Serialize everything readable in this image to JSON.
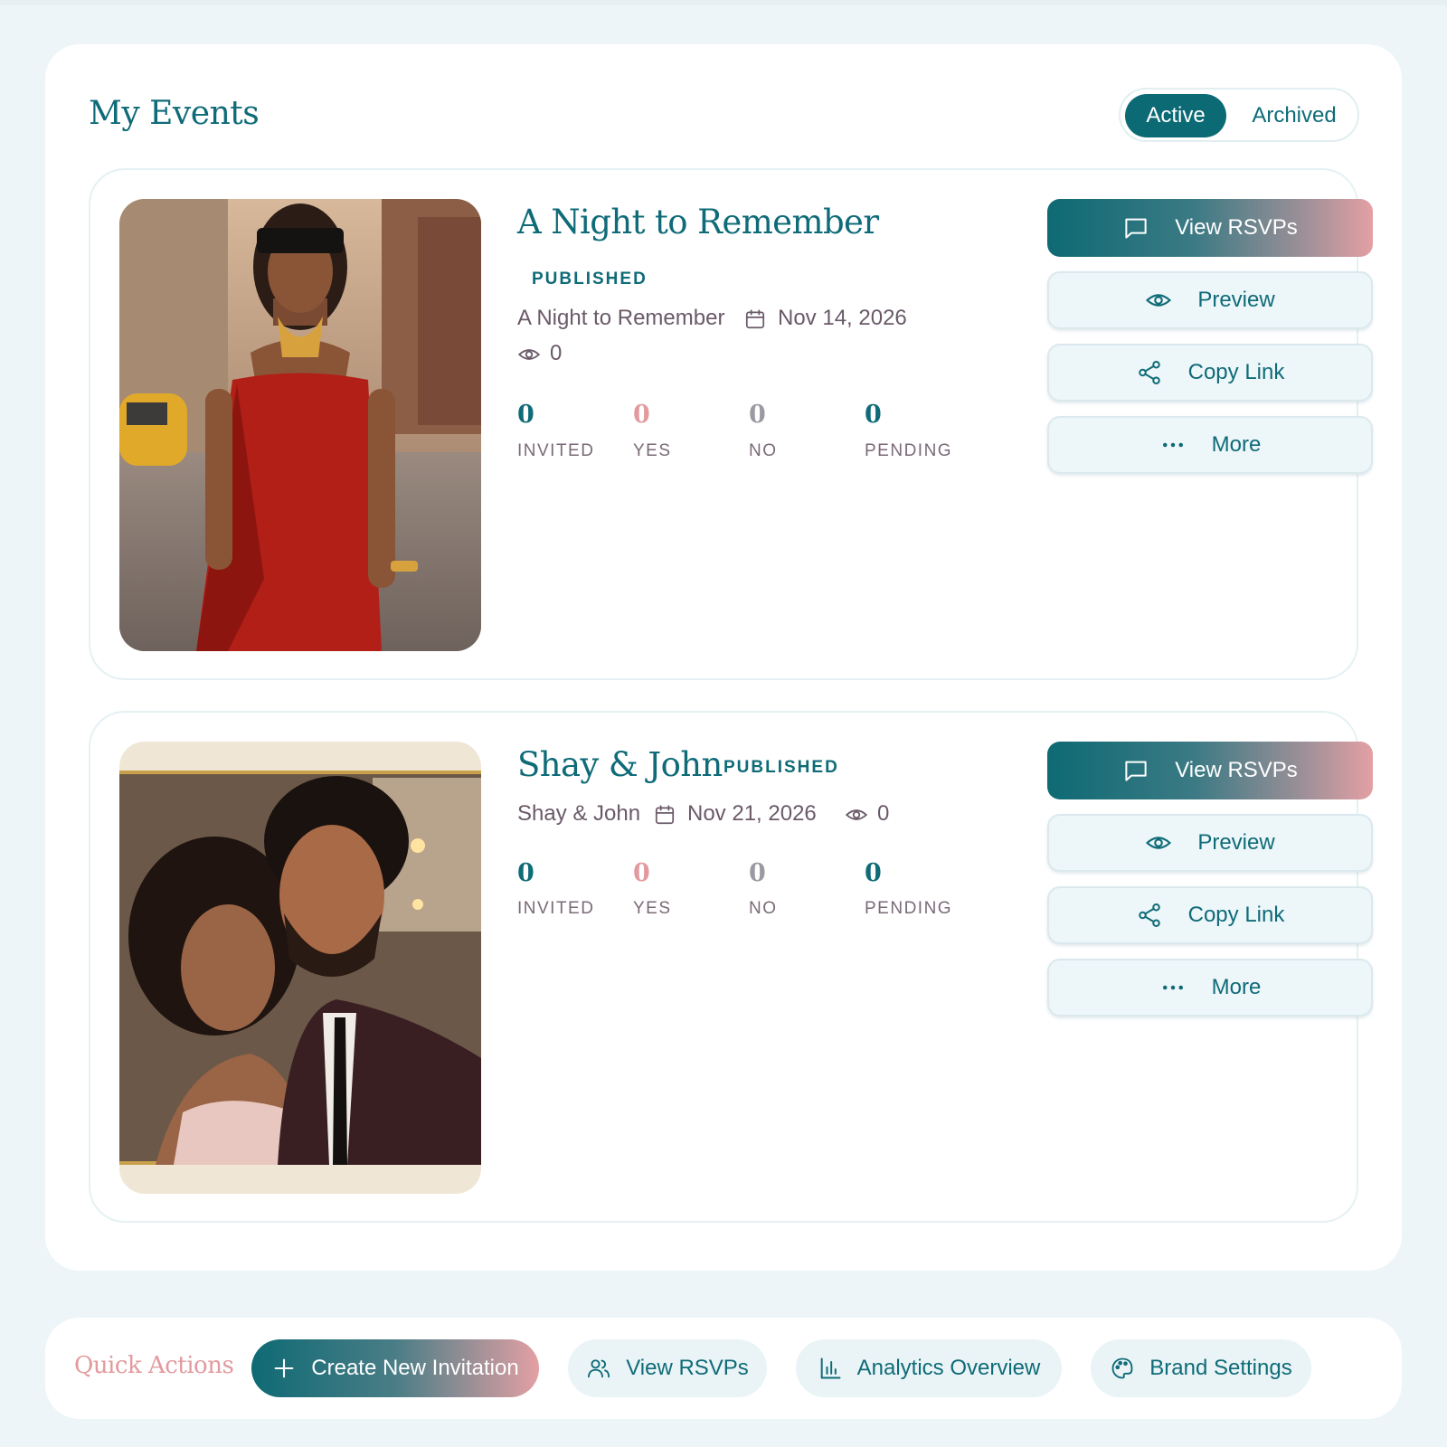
{
  "panel": {
    "title": "My Events",
    "filter": {
      "active_label": "Active",
      "archived_label": "Archived",
      "selected": "Active"
    }
  },
  "events": [
    {
      "title": "A Night to Remember",
      "status": "PUBLISHED",
      "subtitle": "A Night to Remember",
      "date": "Nov 14, 2026",
      "views": "0",
      "stats": {
        "invited": "0",
        "invited_label": "INVITED",
        "yes": "0",
        "yes_label": "YES",
        "no": "0",
        "no_label": "NO",
        "pending": "0",
        "pending_label": "PENDING"
      },
      "actions": {
        "view_rsvps": "View RSVPs",
        "preview": "Preview",
        "copy_link": "Copy Link",
        "more": "More"
      }
    },
    {
      "title": "Shay & John",
      "status": "PUBLISHED",
      "subtitle": "Shay & John",
      "date": "Nov 21, 2026",
      "views": "0",
      "stats": {
        "invited": "0",
        "invited_label": "INVITED",
        "yes": "0",
        "yes_label": "YES",
        "no": "0",
        "no_label": "NO",
        "pending": "0",
        "pending_label": "PENDING"
      },
      "actions": {
        "view_rsvps": "View RSVPs",
        "preview": "Preview",
        "copy_link": "Copy Link",
        "more": "More"
      }
    }
  ],
  "quick_actions": {
    "label": "Quick Actions",
    "create": "Create New Invitation",
    "view_rsvps": "View RSVPs",
    "analytics": "Analytics Overview",
    "brand": "Brand Settings"
  },
  "colors": {
    "brand_teal": "#0f6b78",
    "accent_pink": "#e29a9e",
    "background": "#edf5f8",
    "stat_invited": "#0f6b78",
    "stat_yes": "#e29a9e",
    "stat_no": "#9a9aa2",
    "stat_pending": "#0f6b78"
  },
  "icons": [
    "message-square-icon",
    "eye-icon",
    "share-icon",
    "ellipsis-icon",
    "calendar-icon",
    "plus-icon",
    "users-icon",
    "bar-chart-icon",
    "palette-icon"
  ]
}
